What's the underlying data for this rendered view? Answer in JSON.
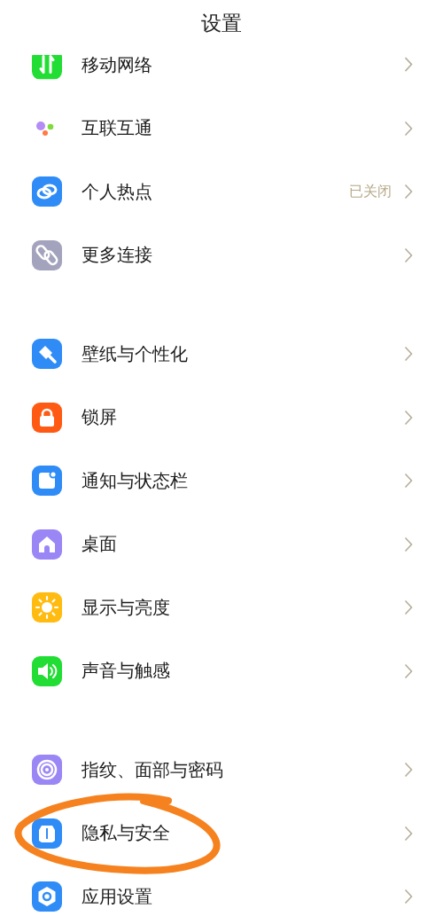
{
  "title": "设置",
  "sections": [
    {
      "items": [
        {
          "label": "移动网络",
          "kind": "network",
          "color": "#22dd33",
          "circled": false
        },
        {
          "label": "互联互通",
          "kind": "dots",
          "circled": false
        },
        {
          "label": "个人热点",
          "kind": "hotspot",
          "color": "#2f8cf7",
          "value": "已关闭",
          "circled": false
        },
        {
          "label": "更多连接",
          "kind": "link",
          "color": "#a3a3bd",
          "circled": false
        }
      ]
    },
    {
      "items": [
        {
          "label": "壁纸与个性化",
          "kind": "brush",
          "color": "#2f8cf7",
          "circled": false
        },
        {
          "label": "锁屏",
          "kind": "lock",
          "color": "#ff5a14",
          "circled": false
        },
        {
          "label": "通知与状态栏",
          "kind": "notify",
          "color": "#2f8cf7",
          "circled": false
        },
        {
          "label": "桌面",
          "kind": "home",
          "color": "#9b86f5",
          "circled": false
        },
        {
          "label": "显示与亮度",
          "kind": "sun",
          "color": "#ffbb0f",
          "circled": false
        },
        {
          "label": "声音与触感",
          "kind": "sound",
          "color": "#22dd33",
          "circled": false
        }
      ]
    },
    {
      "items": [
        {
          "label": "指纹、面部与密码",
          "kind": "fingerprint",
          "color": "#9b86f5",
          "circled": false
        },
        {
          "label": "隐私与安全",
          "kind": "shield",
          "color": "#2f8cf7",
          "circled": true
        },
        {
          "label": "应用设置",
          "kind": "hexagon",
          "color": "#2f8cf7",
          "circled": false
        }
      ]
    }
  ]
}
